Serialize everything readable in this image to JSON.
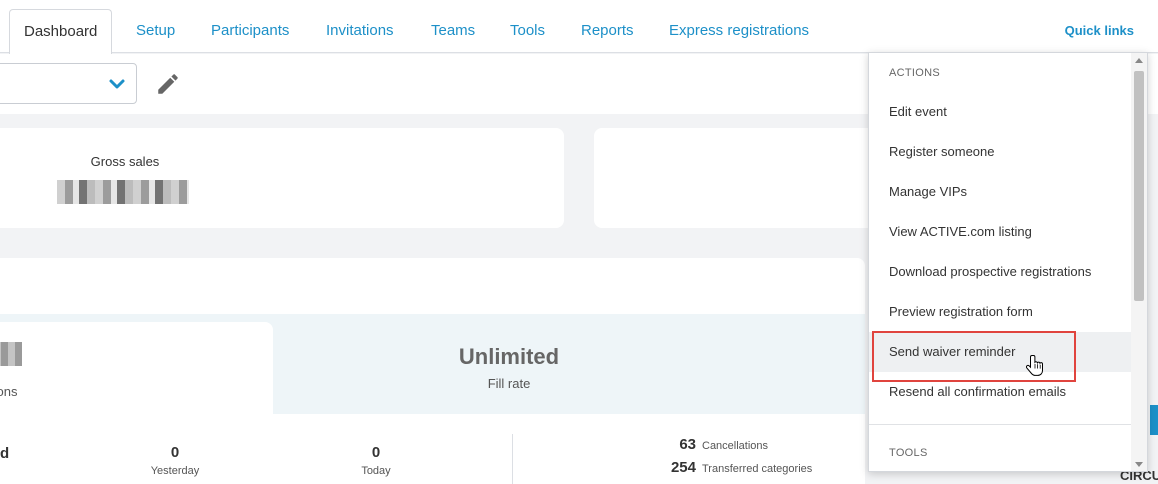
{
  "tabs": [
    {
      "label": "Dashboard",
      "active": true
    },
    {
      "label": "Setup"
    },
    {
      "label": "Participants"
    },
    {
      "label": "Invitations"
    },
    {
      "label": "Teams"
    },
    {
      "label": "Tools"
    },
    {
      "label": "Reports"
    },
    {
      "label": "Express registrations"
    }
  ],
  "quick_links": "Quick links",
  "summary": {
    "gross_sales_label": "Gross sales"
  },
  "stats": {
    "registrations_partial": "tions",
    "fill_rate_value": "Unlimited",
    "fill_rate_label": "Fill rate",
    "partial_value": "d",
    "yesterday": {
      "value": "0",
      "label": "Yesterday"
    },
    "today": {
      "value": "0",
      "label": "Today"
    },
    "cancellations": {
      "value": "63",
      "label": "Cancellations"
    },
    "transferred": {
      "value": "254",
      "label": "Transferred categories"
    }
  },
  "dropdown": {
    "actions_heading": "ACTIONS",
    "items": [
      "Edit event",
      "Register someone",
      "Manage VIPs",
      "View ACTIVE.com listing",
      "Download prospective registrations",
      "Preview registration form",
      "Send waiver reminder",
      "Resend all confirmation emails"
    ],
    "tools_heading": "TOOLS"
  },
  "partial_text_right": "CIRCU",
  "colors": {
    "accent": "#1d90c8",
    "highlight_border": "#e0443e",
    "background": "#f2f3f5"
  },
  "icons": [
    "chevron-down-icon",
    "pencil-icon",
    "hand-pointer-icon",
    "scroll-up-icon",
    "scroll-down-icon"
  ]
}
